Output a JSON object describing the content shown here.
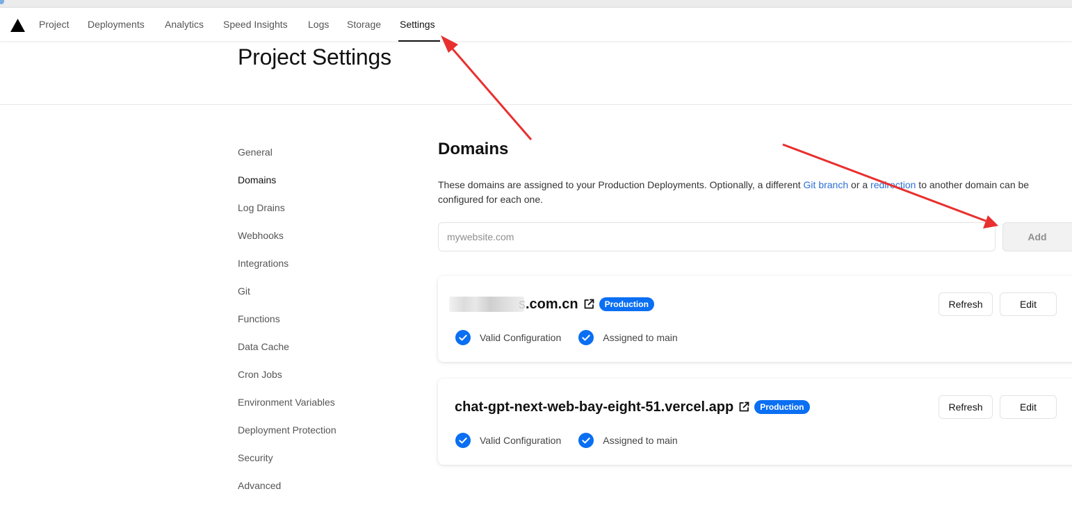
{
  "nav": {
    "logo_icon": "triangle-logo-icon",
    "tabs": [
      {
        "label": "Project",
        "active": false
      },
      {
        "label": "Deployments",
        "active": false
      },
      {
        "label": "Analytics",
        "active": false
      },
      {
        "label": "Speed Insights",
        "active": false
      },
      {
        "label": "Logs",
        "active": false
      },
      {
        "label": "Storage",
        "active": false
      },
      {
        "label": "Settings",
        "active": true
      }
    ]
  },
  "page": {
    "title": "Project Settings"
  },
  "sidebar": {
    "items": [
      {
        "label": "General",
        "active": false
      },
      {
        "label": "Domains",
        "active": true
      },
      {
        "label": "Log Drains",
        "active": false
      },
      {
        "label": "Webhooks",
        "active": false
      },
      {
        "label": "Integrations",
        "active": false
      },
      {
        "label": "Git",
        "active": false
      },
      {
        "label": "Functions",
        "active": false
      },
      {
        "label": "Data Cache",
        "active": false
      },
      {
        "label": "Cron Jobs",
        "active": false
      },
      {
        "label": "Environment Variables",
        "active": false
      },
      {
        "label": "Deployment Protection",
        "active": false
      },
      {
        "label": "Security",
        "active": false
      },
      {
        "label": "Advanced",
        "active": false
      }
    ]
  },
  "domains": {
    "title": "Domains",
    "description_part1": "These domains are assigned to your Production Deployments. Optionally, a different ",
    "link_git_branch": "Git branch",
    "description_part2": " or a ",
    "link_redirection": "redirection",
    "description_part3": " to another domain can be configured for each one.",
    "input_placeholder": "mywebsite.com",
    "input_value": "",
    "add_label": "Add",
    "cards": [
      {
        "domain_prefix": "s",
        "domain_suffix": ".com.cn",
        "obscured": true,
        "badge": "Production",
        "status_1": "Valid Configuration",
        "status_2": "Assigned to main",
        "refresh_label": "Refresh",
        "edit_label": "Edit"
      },
      {
        "domain_prefix": "",
        "domain_suffix": "chat-gpt-next-web-bay-eight-51.vercel.app",
        "obscured": false,
        "badge": "Production",
        "status_1": "Valid Configuration",
        "status_2": "Assigned to main",
        "refresh_label": "Refresh",
        "edit_label": "Edit"
      }
    ]
  },
  "colors": {
    "accent_blue": "#0a6ff2",
    "link_blue": "#2b6fd6",
    "annotation_red": "#e8302f"
  }
}
